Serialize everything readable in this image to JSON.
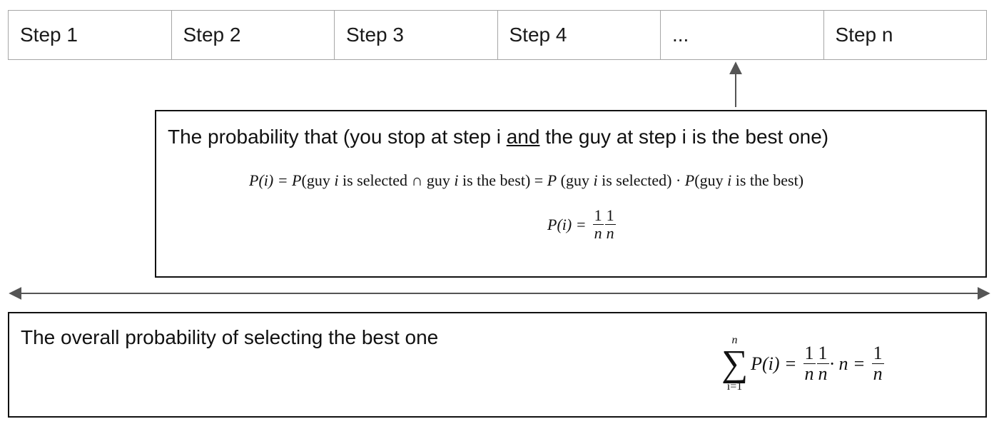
{
  "steps": [
    "Step 1",
    "Step 2",
    "Step 3",
    "Step 4",
    "...",
    "Step n"
  ],
  "single_box": {
    "heading_before": "The probability that (you stop at step i ",
    "heading_underlined": "and",
    "heading_after": " the guy at step i is the best one)",
    "eq1": {
      "lhs": "P(i) = P",
      "t1": "(guy ",
      "var1": "i",
      "t2": " is selected ∩ guy ",
      "var2": "i",
      "t3": " is the best) = ",
      "p2": "P",
      "t4": " (guy ",
      "var3": "i",
      "t5": " is selected) · ",
      "p3": "P",
      "t6": "(guy ",
      "var4": "i",
      "t7": " is the best)"
    },
    "eq2": {
      "lhs": "P(i) = ",
      "frac1_num": "1",
      "frac1_den": "n",
      "frac2_num": "1",
      "frac2_den": "n"
    }
  },
  "overall_box": {
    "heading": "The overall probability of selecting the best one",
    "eq3": {
      "sum_upper": "n",
      "sum_lower": "i=1",
      "sigma": "∑",
      "term": "P(i) = ",
      "frac1_num": "1",
      "frac1_den": "n",
      "frac2_num": "1",
      "frac2_den": "n",
      "times_n": " · n = ",
      "result_num": "1",
      "result_den": "n"
    }
  },
  "colors": {
    "cell_border": "#a6a6a6",
    "box_border": "#111111",
    "arrow": "#555555"
  }
}
